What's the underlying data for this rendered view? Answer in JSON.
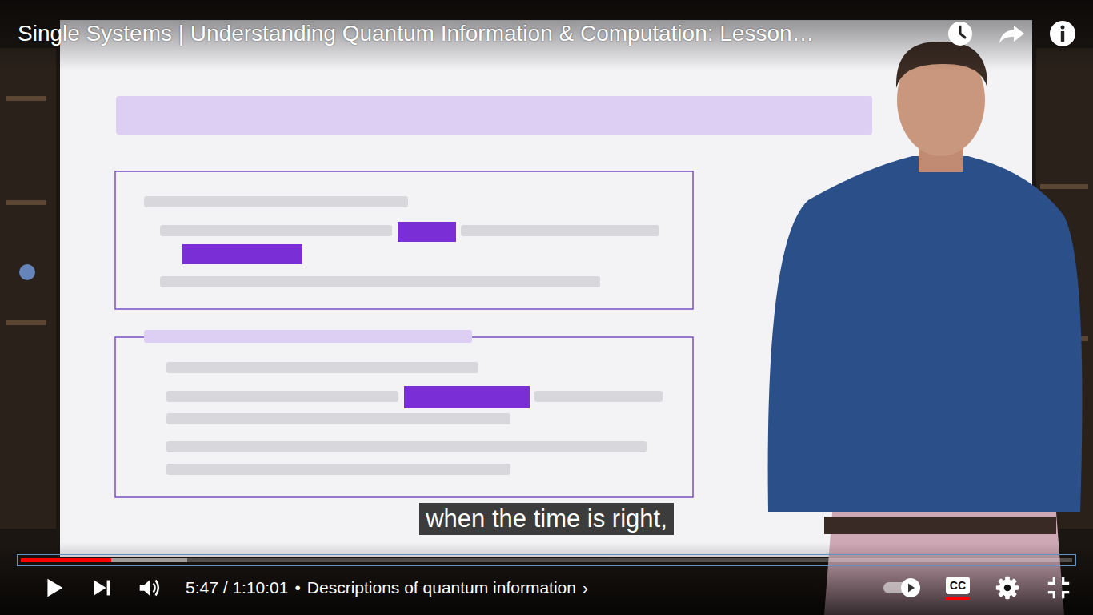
{
  "video": {
    "title": "Single Systems | Understanding Quantum Information & Computation: Lesson…"
  },
  "caption": "when the time is right,",
  "progress": {
    "level": 0.086,
    "buffered": 0.158
  },
  "time": {
    "current": "5:47",
    "separator": " / ",
    "duration": "1:10:01"
  },
  "chapter": {
    "bullet": "•",
    "title": "Descriptions of quantum information",
    "arrow": "›"
  },
  "controls": {
    "autoplay": {
      "on": true
    },
    "captions": {
      "label": "CC",
      "on": true
    }
  }
}
